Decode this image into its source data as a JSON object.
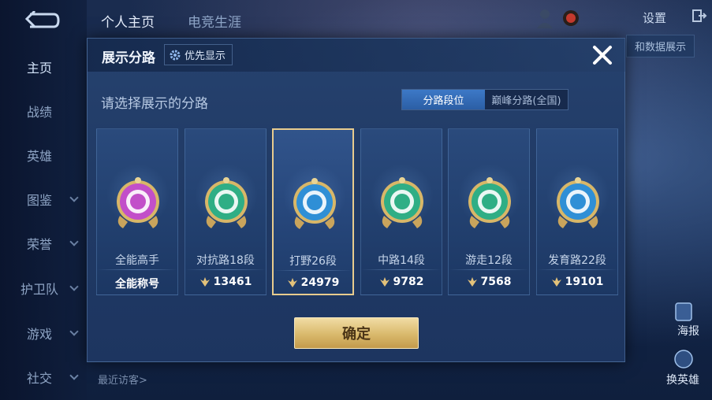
{
  "nav": {
    "items": [
      {
        "label": "主页"
      },
      {
        "label": "战绩"
      },
      {
        "label": "英雄"
      },
      {
        "label": "图鉴"
      },
      {
        "label": "荣誉"
      },
      {
        "label": "护卫队"
      },
      {
        "label": "游戏"
      },
      {
        "label": "社交"
      }
    ]
  },
  "top_tabs": [
    "个人主页",
    "电竞生涯"
  ],
  "top_right": {
    "settings_label": "设置",
    "data_display_label": "和数据展示"
  },
  "right_actions": {
    "poster": "海报",
    "swap_hero": "换英雄"
  },
  "recent_visitors": "最近访客>",
  "modal": {
    "title": "展示分路",
    "priority_button": "优先显示",
    "prompt": "请选择展示的分路",
    "toggle": {
      "left": "分路段位",
      "right": "巅峰分路(全国)"
    },
    "confirm": "确定",
    "cards": [
      {
        "name": "全能高手",
        "stat": "全能称号",
        "has_icon": false,
        "color": "#c24fc9",
        "emblem": "all-round-emblem-icon"
      },
      {
        "name": "对抗路18段",
        "stat": "13461",
        "has_icon": true,
        "color": "#2fae85",
        "emblem": "clash-lane-emblem-icon"
      },
      {
        "name": "打野26段",
        "stat": "24979",
        "has_icon": true,
        "color": "#2f8fd6",
        "emblem": "jungle-emblem-icon"
      },
      {
        "name": "中路14段",
        "stat": "9782",
        "has_icon": true,
        "color": "#2fae85",
        "emblem": "mid-lane-emblem-icon"
      },
      {
        "name": "游走12段",
        "stat": "7568",
        "has_icon": true,
        "color": "#2fae85",
        "emblem": "roam-emblem-icon"
      },
      {
        "name": "发育路22段",
        "stat": "19101",
        "has_icon": true,
        "color": "#2f8fd6",
        "emblem": "farm-lane-emblem-icon"
      }
    ],
    "selected_index": 2
  }
}
